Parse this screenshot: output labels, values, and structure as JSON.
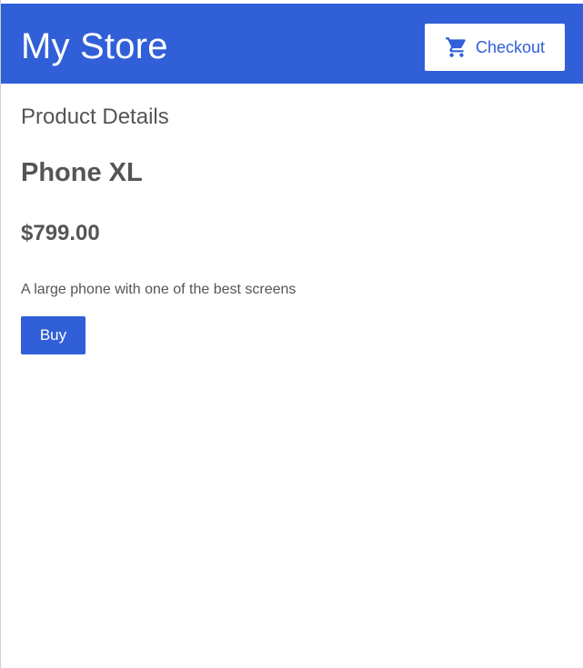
{
  "header": {
    "store_title": "My Store",
    "checkout_label": "Checkout",
    "checkout_icon": "shopping-cart-icon",
    "background_color": "#315fd8"
  },
  "main": {
    "section_heading": "Product Details",
    "product": {
      "name": "Phone XL",
      "price": "$799.00",
      "description": "A large phone with one of the best screens"
    },
    "buy_label": "Buy"
  },
  "colors": {
    "accent": "#315fd8",
    "text": "#555555",
    "background": "#ffffff"
  }
}
